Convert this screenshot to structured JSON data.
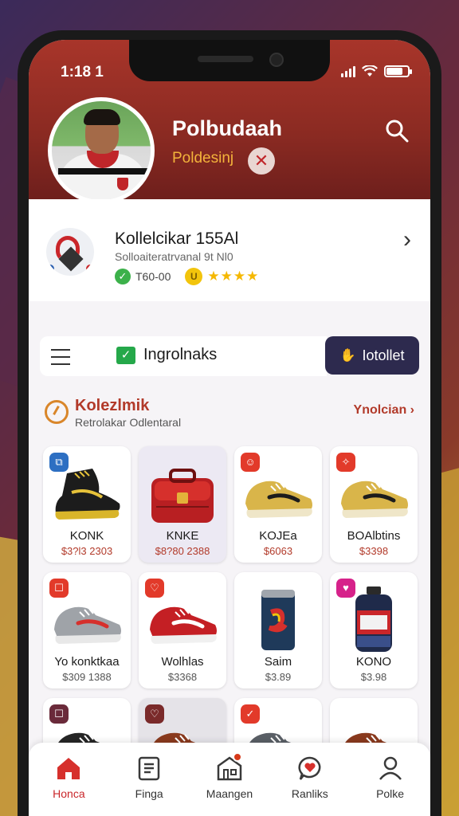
{
  "status_bar": {
    "time": "1:18 1"
  },
  "profile": {
    "name": "Polbudaah",
    "subtitle": "Poldesinj",
    "close_symbol": "✕"
  },
  "collection": {
    "title": "Kollelcikar 155Al",
    "subtitle": "Solloaiteratrvanal 9t Nl0",
    "rating_text": "T60-00",
    "coin_label": "U",
    "stars": "★★★★"
  },
  "tabs": {
    "active_label": "Ingrolnaks",
    "collect_button": "Iotollet"
  },
  "section": {
    "title": "Kolezlmik",
    "subtitle": "Retrolakar Odlentaral",
    "link": "Ynolcian ›"
  },
  "items": [
    {
      "name": "KONK",
      "price": "$3?l3 2303",
      "badge": "⧉",
      "badge_color": "#2d6fc2",
      "kind": "boot-black"
    },
    {
      "name": "KNKE",
      "price": "$8?80 2388",
      "badge": "",
      "badge_color": "",
      "kind": "bag-red"
    },
    {
      "name": "KOJEa",
      "price": "$6063",
      "badge": "☺",
      "badge_color": "#e23a2a",
      "kind": "shoe-gold"
    },
    {
      "name": "BOAlbtins",
      "price": "$3398",
      "badge": "✧",
      "badge_color": "#e23a2a",
      "kind": "shoe-gold"
    },
    {
      "name": "Yo konktkaa",
      "price": "$309 1388",
      "badge": "☐",
      "badge_color": "#e23a2a",
      "kind": "shoe-silver"
    },
    {
      "name": "Wolhlas",
      "price": "$3368",
      "badge": "♡",
      "badge_color": "#e23a2a",
      "kind": "shoe-red"
    },
    {
      "name": "Saim",
      "price": "$3.89",
      "badge": "",
      "badge_color": "",
      "kind": "can"
    },
    {
      "name": "KONO",
      "price": "$3.98",
      "badge": "♥",
      "badge_color": "#d6228a",
      "kind": "bottle"
    },
    {
      "name": "",
      "price": "",
      "badge": "☐",
      "badge_color": "#6a2a3a",
      "kind": "shoe-black"
    },
    {
      "name": "",
      "price": "",
      "badge": "♡",
      "badge_color": "#7a2a2a",
      "kind": "shoe-brown"
    },
    {
      "name": "",
      "price": "",
      "badge": "✓",
      "badge_color": "#e23a2a",
      "kind": "shoe-colorful"
    },
    {
      "name": "",
      "price": "",
      "badge": "",
      "badge_color": "",
      "kind": "shoe-brown"
    }
  ],
  "bottom_nav": [
    {
      "label": "Honca",
      "icon": "home-icon",
      "active": true
    },
    {
      "label": "Finga",
      "icon": "document-icon",
      "active": false
    },
    {
      "label": "Maangen",
      "icon": "store-icon",
      "active": false
    },
    {
      "label": "Ranliks",
      "icon": "chat-heart-icon",
      "active": false
    },
    {
      "label": "Polke",
      "icon": "profile-icon",
      "active": false
    }
  ],
  "colors": {
    "header": "#a8352a",
    "accent": "#c9262a",
    "button_dark": "#2d2a4e"
  }
}
